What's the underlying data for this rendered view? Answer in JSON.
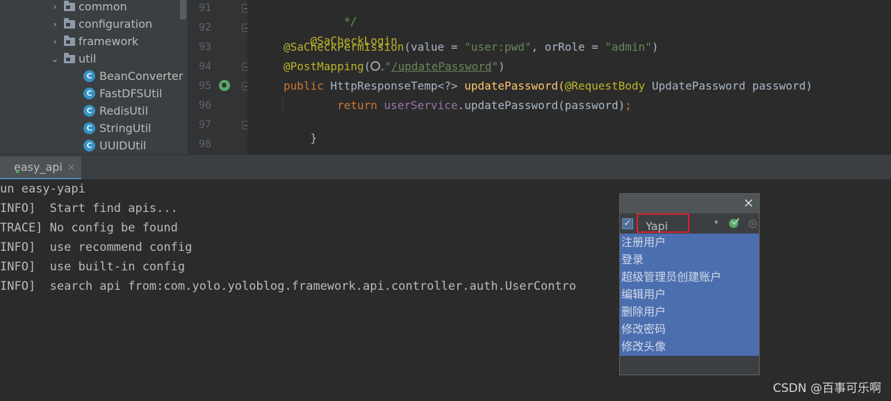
{
  "project_tree": {
    "items": [
      {
        "type": "folder",
        "expanded": false,
        "label": "common"
      },
      {
        "type": "folder",
        "expanded": false,
        "label": "configuration"
      },
      {
        "type": "folder",
        "expanded": false,
        "label": "framework"
      },
      {
        "type": "folder",
        "expanded": true,
        "label": "util"
      },
      {
        "type": "class",
        "label": "BeanConverter"
      },
      {
        "type": "class",
        "label": "FastDFSUtil"
      },
      {
        "type": "class",
        "label": "RedisUtil"
      },
      {
        "type": "class",
        "label": "StringUtil"
      },
      {
        "type": "class",
        "label": "UUIDUtil"
      }
    ],
    "collapsed_arrow": "›",
    "expanded_arrow": "⌄",
    "class_icon_letter": "C"
  },
  "editor": {
    "line_numbers": [
      "91",
      "92",
      "93",
      "94",
      "95",
      "96",
      "97",
      "98"
    ],
    "code": {
      "l91": "     */",
      "l92_anno": "@SaCheckLogin",
      "l93_anno": "@SaCheckPermission",
      "l93_open": "(value = ",
      "l93_str1": "\"user:pwd\"",
      "l93_mid": ", orRole = ",
      "l93_str2": "\"admin\"",
      "l93_close": ")",
      "l94_anno": "@PostMapping",
      "l94_open": "(",
      "l94_quote_open": "\"",
      "l94_path": "/updatePassword",
      "l94_quote_close": "\"",
      "l94_close": ")",
      "l95_kw": "public",
      "l95_type": " HttpResponseTemp<?> ",
      "l95_method": "updatePassword",
      "l95_paren": "(",
      "l95_anno": "@RequestBody",
      "l95_rest": " UpdatePassword password) ",
      "l96_indent": "        ",
      "l96_kw": "return",
      "l96_field": " userService",
      "l96_rest": ".updatePassword(password)",
      "l96_semi": ";",
      "l97": "}"
    }
  },
  "run_panel": {
    "tab_label": "easy_api",
    "tab_close": "×",
    "console_lines": [
      "un easy-yapi",
      "INFO]  Start find apis...",
      "TRACE] No config be found",
      "INFO]  use recommend config",
      "INFO]  use built-in config",
      "INFO]  search api from:com.yolo.yoloblog.framework.api.controller.auth.UserContro"
    ]
  },
  "popup": {
    "close_glyph": "×",
    "check_glyph": "✓",
    "selected_channel": "Yapi",
    "dropdown_glyph": "▾",
    "cancel_glyph": "⊗",
    "items": [
      "注册用户",
      "登录",
      "超级管理员创建账户",
      "编辑用户",
      "删除用户",
      "修改密码",
      "修改头像"
    ]
  },
  "watermark": "CSDN @百事可乐啊",
  "colors": {
    "accent_selection": "#4b6eaf",
    "highlight_border": "#d8232a",
    "annotation": "#bbb529",
    "keyword": "#cc7832",
    "string": "#6a8759"
  }
}
